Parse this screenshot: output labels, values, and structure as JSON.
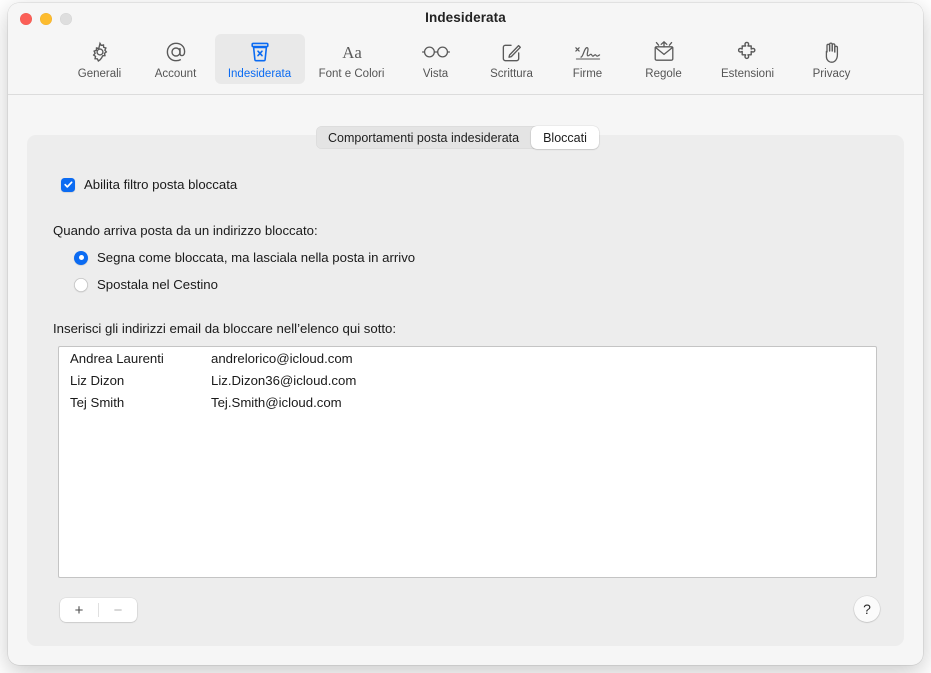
{
  "window": {
    "title": "Indesiderata",
    "controls": {
      "close": "close-button",
      "minimize": "minimize-button",
      "zoom": "zoom-button"
    }
  },
  "toolbar": {
    "items": [
      {
        "label": "Generali",
        "icon": "gear-icon",
        "selected": false
      },
      {
        "label": "Account",
        "icon": "at-sign-icon",
        "selected": false
      },
      {
        "label": "Indesiderata",
        "icon": "junk-bin-icon",
        "selected": true
      },
      {
        "label": "Font e Colori",
        "icon": "font-aa-icon",
        "selected": false
      },
      {
        "label": "Vista",
        "icon": "glasses-icon",
        "selected": false
      },
      {
        "label": "Scrittura",
        "icon": "compose-icon",
        "selected": false
      },
      {
        "label": "Firme",
        "icon": "signature-icon",
        "selected": false
      },
      {
        "label": "Regole",
        "icon": "rules-envelope-icon",
        "selected": false
      },
      {
        "label": "Estensioni",
        "icon": "puzzle-icon",
        "selected": false
      },
      {
        "label": "Privacy",
        "icon": "hand-icon",
        "selected": false
      }
    ]
  },
  "segmented": {
    "tabs": [
      {
        "label": "Comportamenti posta indesiderata",
        "active": false
      },
      {
        "label": "Bloccati",
        "active": true
      }
    ]
  },
  "settings": {
    "enable_checkbox": {
      "label": "Abilita filtro posta bloccata",
      "checked": true
    },
    "when_blocked_label": "Quando arriva posta da un indirizzo bloccato:",
    "radios": [
      {
        "label": "Segna come bloccata, ma lasciala nella posta in arrivo",
        "selected": true
      },
      {
        "label": "Spostala nel Cestino",
        "selected": false
      }
    ],
    "list_label": "Inserisci gli indirizzi email da bloccare nell’elenco qui sotto:"
  },
  "blocked_list": {
    "rows": [
      {
        "name": "Andrea Laurenti",
        "email": "andrelorico@icloud.com"
      },
      {
        "name": "Liz Dizon",
        "email": "Liz.Dizon36@icloud.com"
      },
      {
        "name": "Tej Smith",
        "email": "Tej.Smith@icloud.com"
      }
    ]
  },
  "bottom_bar": {
    "add_label": "+",
    "remove_label": "−",
    "help_label": "?"
  },
  "colors": {
    "accent_blue": "#0b6bf2",
    "window_bg": "#f6f6f6",
    "pane_bg": "#ededed",
    "list_bg": "#ffffff",
    "close_red": "#fb5f57",
    "minimize_yellow": "#fdbc2e",
    "zoom_grey": "#dedede"
  }
}
